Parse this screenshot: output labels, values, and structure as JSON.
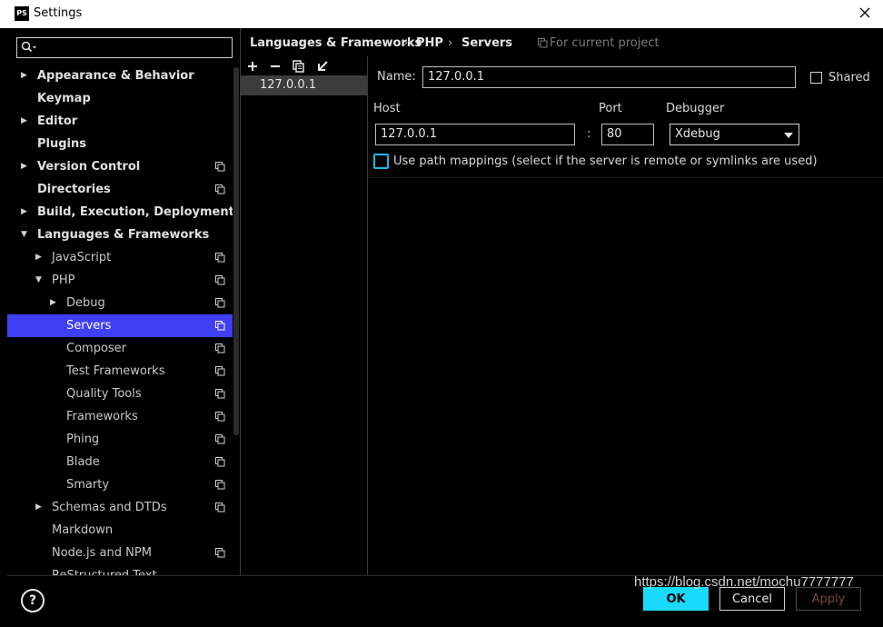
{
  "window": {
    "title": "Settings",
    "app_icon": "PS"
  },
  "search": {
    "placeholder": ""
  },
  "tree": [
    {
      "label": "Appearance & Behavior",
      "bold": true,
      "arrow": "right",
      "indent": 0,
      "proj": false
    },
    {
      "label": "Keymap",
      "bold": true,
      "arrow": "",
      "indent": 0,
      "proj": false
    },
    {
      "label": "Editor",
      "bold": true,
      "arrow": "right",
      "indent": 0,
      "proj": false
    },
    {
      "label": "Plugins",
      "bold": true,
      "arrow": "",
      "indent": 0,
      "proj": false
    },
    {
      "label": "Version Control",
      "bold": true,
      "arrow": "right",
      "indent": 0,
      "proj": true
    },
    {
      "label": "Directories",
      "bold": true,
      "arrow": "",
      "indent": 0,
      "proj": true
    },
    {
      "label": "Build, Execution, Deployment",
      "bold": true,
      "arrow": "right",
      "indent": 0,
      "proj": false
    },
    {
      "label": "Languages & Frameworks",
      "bold": true,
      "arrow": "down",
      "indent": 0,
      "proj": false
    },
    {
      "label": "JavaScript",
      "bold": false,
      "arrow": "right",
      "indent": 1,
      "proj": true
    },
    {
      "label": "PHP",
      "bold": false,
      "arrow": "down",
      "indent": 1,
      "proj": true
    },
    {
      "label": "Debug",
      "bold": false,
      "arrow": "right",
      "indent": 2,
      "proj": true
    },
    {
      "label": "Servers",
      "bold": false,
      "arrow": "",
      "indent": 2,
      "proj": true,
      "selected": true
    },
    {
      "label": "Composer",
      "bold": false,
      "arrow": "",
      "indent": 2,
      "proj": true
    },
    {
      "label": "Test Frameworks",
      "bold": false,
      "arrow": "",
      "indent": 2,
      "proj": true
    },
    {
      "label": "Quality Tools",
      "bold": false,
      "arrow": "",
      "indent": 2,
      "proj": true
    },
    {
      "label": "Frameworks",
      "bold": false,
      "arrow": "",
      "indent": 2,
      "proj": true
    },
    {
      "label": "Phing",
      "bold": false,
      "arrow": "",
      "indent": 2,
      "proj": true
    },
    {
      "label": "Blade",
      "bold": false,
      "arrow": "",
      "indent": 2,
      "proj": true
    },
    {
      "label": "Smarty",
      "bold": false,
      "arrow": "",
      "indent": 2,
      "proj": true
    },
    {
      "label": "Schemas and DTDs",
      "bold": false,
      "arrow": "right",
      "indent": 1,
      "proj": true
    },
    {
      "label": "Markdown",
      "bold": false,
      "arrow": "",
      "indent": 1,
      "proj": false
    },
    {
      "label": "Node.js and NPM",
      "bold": false,
      "arrow": "",
      "indent": 1,
      "proj": true
    },
    {
      "label": "ReStructured Text",
      "bold": false,
      "arrow": "",
      "indent": 1,
      "proj": false
    }
  ],
  "breadcrumb": {
    "part1": "Languages & Frameworks",
    "part2": "PHP",
    "part3": "Servers",
    "sep": "›"
  },
  "scope_note": "For current project",
  "toolbar": {
    "add": "+",
    "remove": "−"
  },
  "servers": [
    "127.0.0.1"
  ],
  "form": {
    "name_label": "Name:",
    "name_value": "127.0.0.1",
    "shared_label": "Shared",
    "host_label": "Host",
    "host_value": "127.0.0.1",
    "colon": ":",
    "port_label": "Port",
    "port_value": "80",
    "debugger_label": "Debugger",
    "debugger_value": "Xdebug",
    "path_mappings_label": "Use path mappings (select if the server is remote or symlinks are used)"
  },
  "footer": {
    "help": "?",
    "ok": "OK",
    "cancel": "Cancel",
    "apply": "Apply"
  },
  "watermark": "https://blog.csdn.net/mochu7777777",
  "colors": {
    "accent": "#1ad9ff",
    "selection": "#3f3ff5",
    "focus": "#1fb6e6"
  }
}
